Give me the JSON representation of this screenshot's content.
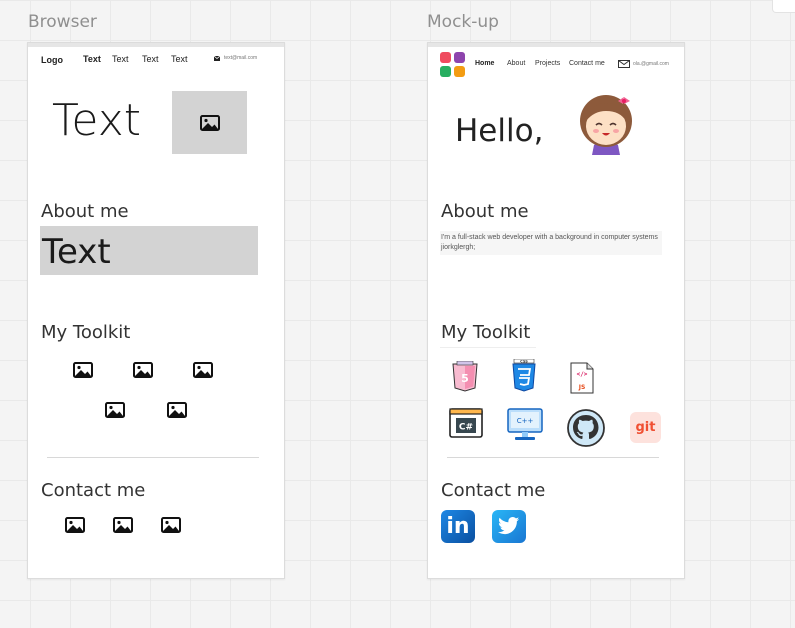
{
  "frames": {
    "browser": {
      "label": "Browser",
      "nav": {
        "logo": "Logo",
        "links": [
          "Text",
          "Text",
          "Text",
          "Text"
        ],
        "email": "text@mail.com"
      },
      "hero_text": "Text",
      "about_heading": "About me",
      "about_text": "Text",
      "toolkit_heading": "My Toolkit",
      "contact_heading": "Contact me"
    },
    "mockup": {
      "label": "Mock-up",
      "nav": {
        "links": [
          "Home",
          "About",
          "Projects",
          "Contact me"
        ],
        "email": "ola.@gmail.com"
      },
      "hero_text": "Hello,",
      "about_heading": "About me",
      "about_text": "I'm a full-stack web developer with a background in computer systems jiorkglergh;",
      "toolkit_heading": "My Toolkit",
      "toolkit_icons": [
        "html5-icon",
        "css3-icon",
        "javascript-icon",
        "csharp-icon",
        "cpp-icon",
        "github-icon",
        "git-icon"
      ],
      "git_label": "git",
      "csharp_label": "C#",
      "cpp_label": "C++",
      "js_label": "JS",
      "contact_heading": "Contact me",
      "linkedin_label": "in"
    }
  },
  "colors": {
    "placeholder_gray": "#d3d3d3",
    "linkedin": "#0a66c2",
    "twitter": "#1d9bf0",
    "html5": "#e44d26",
    "css3": "#1572b6",
    "git": "#f05033"
  }
}
